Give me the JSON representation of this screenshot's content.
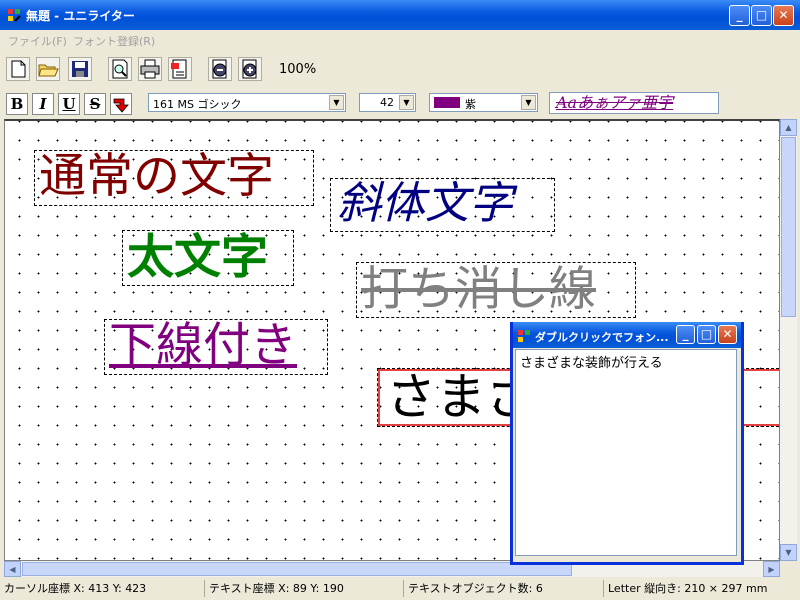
{
  "window": {
    "title": "無題 - ユニライター"
  },
  "menu": {
    "items": [
      "ファイル(F)",
      "フォント登録(R)"
    ]
  },
  "toolbar": {
    "icons": [
      "new-document-icon",
      "open-folder-icon",
      "save-disk-icon",
      "print-preview-icon",
      "print-icon",
      "page-setup-icon",
      "zoom-out-icon",
      "zoom-in-icon"
    ],
    "zoom": "100%"
  },
  "format": {
    "bold_label": "B",
    "italic_label": "I",
    "underline_label": "U",
    "strike_label": "S",
    "font_name": "161 MS ゴシック",
    "font_size": "42",
    "color_name": "紫",
    "color_hex": "#800080",
    "preview_text": "Aaあぁアァ亜宇"
  },
  "canvas": {
    "objects": [
      {
        "text": "通常の文字",
        "color": "#800000",
        "style": "normal"
      },
      {
        "text": "斜体文字",
        "color": "#000080",
        "style": "italic"
      },
      {
        "text": "太文字",
        "color": "#008000",
        "style": "bold"
      },
      {
        "text": "打ち消し線",
        "color": "#808080",
        "style": "strike"
      },
      {
        "text": "下線付き",
        "color": "#800080",
        "style": "underline"
      },
      {
        "text": "さまざまな装飾",
        "color": "#000000",
        "style": "selected"
      }
    ]
  },
  "dialog": {
    "title": "ダブルクリックでフォン...",
    "content": "さまざまな装飾が行える"
  },
  "status": {
    "cursor": "カーソル座標  X: 413  Y: 423",
    "text_coord": "テキスト座標  X: 89  Y: 190",
    "object_count": "テキストオブジェクト数: 6",
    "paper": "Letter 縦向き: 210 × 297 mm"
  }
}
